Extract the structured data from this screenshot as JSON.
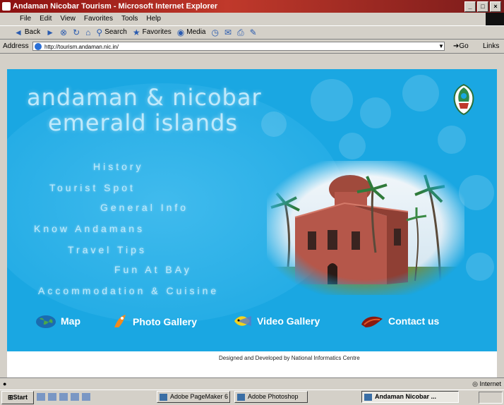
{
  "window": {
    "title": "Andaman Nicobar Tourism - Microsoft Internet Explorer",
    "buttons": [
      "_",
      "□",
      "×"
    ]
  },
  "menu": [
    "File",
    "Edit",
    "View",
    "Favorites",
    "Tools",
    "Help"
  ],
  "toolbar": {
    "back": "Back",
    "search": "Search",
    "favorites": "Favorites",
    "media": "Media"
  },
  "address": {
    "label": "Address",
    "url": "http://tourism.andaman.nic.in/",
    "go": "Go",
    "links": "Links"
  },
  "site": {
    "title_line1": "andaman & nicobar",
    "title_line2": "emerald islands",
    "nav": [
      "History",
      "Tourist Spot",
      "General Info",
      "Know Andamans",
      "Travel Tips",
      "Fun At BAy",
      "Accommodation & Cuisine"
    ],
    "bottom_links": [
      "Map",
      "Photo Gallery",
      "Video Gallery",
      "Contact us"
    ],
    "credit": "Designed and Developed by National Informatics Centre"
  },
  "status": {
    "zone": "Internet"
  },
  "taskbar": {
    "start": "Start",
    "tasks": [
      "Adobe PageMaker 6",
      "Adobe Photoshop",
      "Andaman Nicobar ..."
    ]
  },
  "colors": {
    "banner": "#1aa7e2",
    "title_text": "#bfe9fb",
    "titlebar": "#8a1010"
  }
}
